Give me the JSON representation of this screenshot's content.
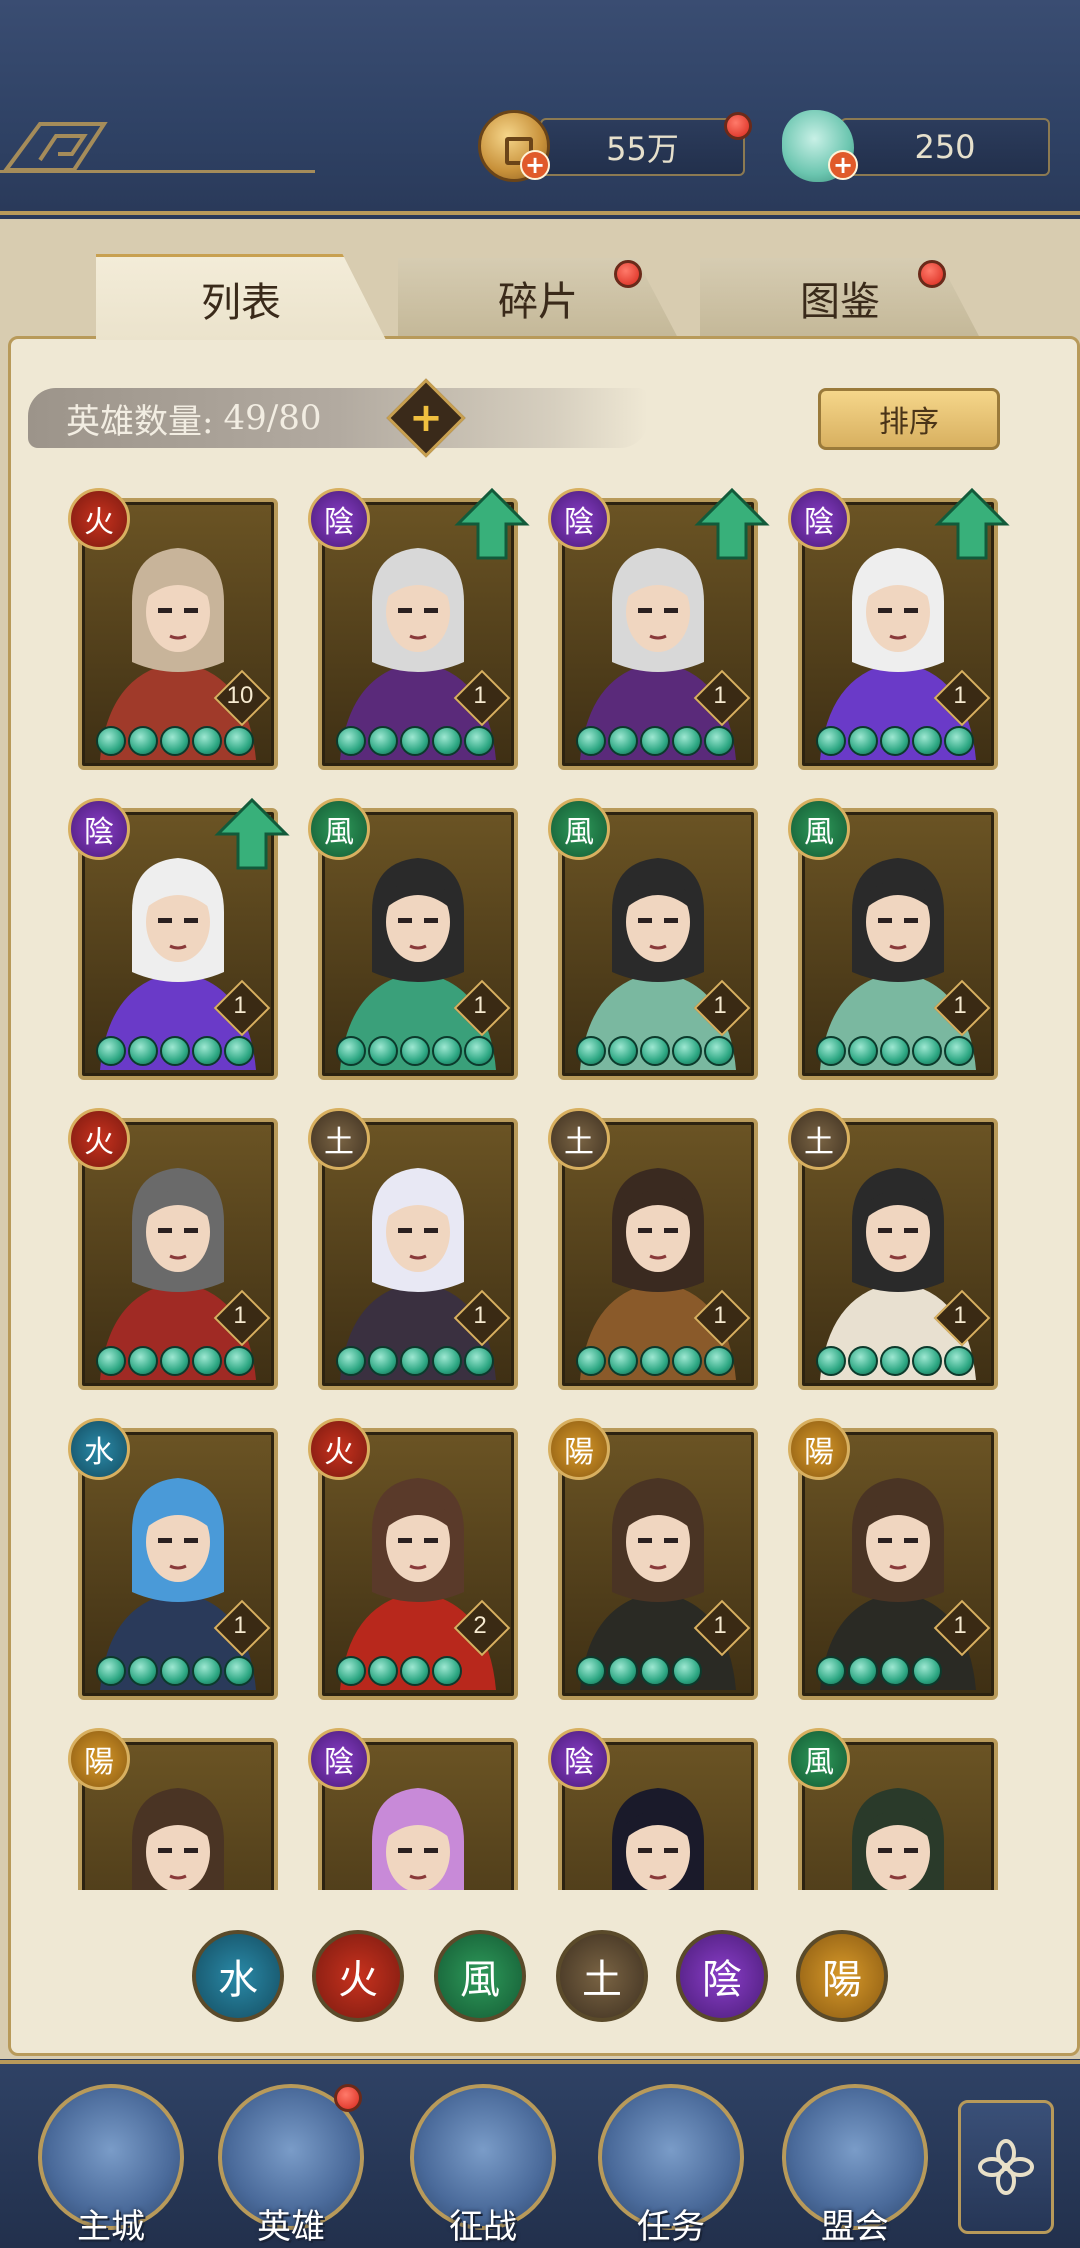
{
  "currency": {
    "coin": "55万",
    "jade": "250"
  },
  "tabs": [
    {
      "label": "列表",
      "active": true
    },
    {
      "label": "碎片",
      "active": false
    },
    {
      "label": "图鉴",
      "active": false
    }
  ],
  "hero_count": {
    "label": "英雄数量:",
    "value": "49/80"
  },
  "sort_label": "排序",
  "elements": {
    "fire": "火",
    "yin": "陰",
    "wind": "風",
    "earth": "土",
    "water": "水",
    "yang": "陽"
  },
  "heroes": [
    {
      "element": "fire",
      "level": "10",
      "stars": 5,
      "upgrade": false,
      "palette": [
        "#c8b49a",
        "#a03a2a"
      ]
    },
    {
      "element": "yin",
      "level": "1",
      "stars": 5,
      "upgrade": true,
      "palette": [
        "#d8d8d8",
        "#5a2a7a"
      ]
    },
    {
      "element": "yin",
      "level": "1",
      "stars": 5,
      "upgrade": true,
      "palette": [
        "#d8d8d8",
        "#5a2a7a"
      ]
    },
    {
      "element": "yin",
      "level": "1",
      "stars": 5,
      "upgrade": true,
      "palette": [
        "#eeeeee",
        "#6a3ac8"
      ]
    },
    {
      "element": "yin",
      "level": "1",
      "stars": 5,
      "upgrade": true,
      "palette": [
        "#eeeeee",
        "#6a3ac8"
      ]
    },
    {
      "element": "wind",
      "level": "1",
      "stars": 5,
      "upgrade": false,
      "palette": [
        "#2a2a2a",
        "#3aa07a"
      ]
    },
    {
      "element": "wind",
      "level": "1",
      "stars": 5,
      "upgrade": false,
      "palette": [
        "#2a2a2a",
        "#7ab8a0"
      ]
    },
    {
      "element": "wind",
      "level": "1",
      "stars": 5,
      "upgrade": false,
      "palette": [
        "#2a2a2a",
        "#7ab8a0"
      ]
    },
    {
      "element": "fire",
      "level": "1",
      "stars": 5,
      "upgrade": false,
      "palette": [
        "#6a6a6a",
        "#a02a24"
      ]
    },
    {
      "element": "earth",
      "level": "1",
      "stars": 5,
      "upgrade": false,
      "palette": [
        "#e8e8f4",
        "#3a3040"
      ]
    },
    {
      "element": "earth",
      "level": "1",
      "stars": 5,
      "upgrade": false,
      "palette": [
        "#3a2a20",
        "#8a5a2a"
      ]
    },
    {
      "element": "earth",
      "level": "1",
      "stars": 5,
      "upgrade": false,
      "palette": [
        "#2a2a2a",
        "#e8e0d0"
      ]
    },
    {
      "element": "water",
      "level": "1",
      "stars": 5,
      "upgrade": false,
      "palette": [
        "#4a9ad8",
        "#2a3a5a"
      ]
    },
    {
      "element": "fire",
      "level": "2",
      "stars": 4,
      "upgrade": false,
      "palette": [
        "#5a3a2a",
        "#b8281c"
      ]
    },
    {
      "element": "yang",
      "level": "1",
      "stars": 4,
      "upgrade": false,
      "palette": [
        "#4a3424",
        "#2a2a24"
      ]
    },
    {
      "element": "yang",
      "level": "1",
      "stars": 4,
      "upgrade": false,
      "palette": [
        "#4a3424",
        "#2a2a24"
      ]
    },
    {
      "element": "yang",
      "level": "",
      "stars": 0,
      "upgrade": false,
      "palette": [
        "#4a3424",
        "#2a2a24"
      ]
    },
    {
      "element": "yin",
      "level": "",
      "stars": 0,
      "upgrade": false,
      "palette": [
        "#c88ad8",
        "#3a2a5a"
      ]
    },
    {
      "element": "yin",
      "level": "",
      "stars": 0,
      "upgrade": false,
      "palette": [
        "#1a1a2a",
        "#3a2a4a"
      ]
    },
    {
      "element": "wind",
      "level": "",
      "stars": 0,
      "upgrade": false,
      "palette": [
        "#2a3a2a",
        "#a0b080"
      ]
    }
  ],
  "filters": [
    "water",
    "fire",
    "wind",
    "earth",
    "yin",
    "yang"
  ],
  "nav": [
    {
      "label": "主城",
      "icon": "city-gate-icon"
    },
    {
      "label": "英雄",
      "icon": "hero-portrait-icon"
    },
    {
      "label": "征战",
      "icon": "battle-helmet-icon"
    },
    {
      "label": "任务",
      "icon": "task-scroll-icon"
    },
    {
      "label": "盟会",
      "icon": "alliance-pavilion-icon"
    }
  ]
}
